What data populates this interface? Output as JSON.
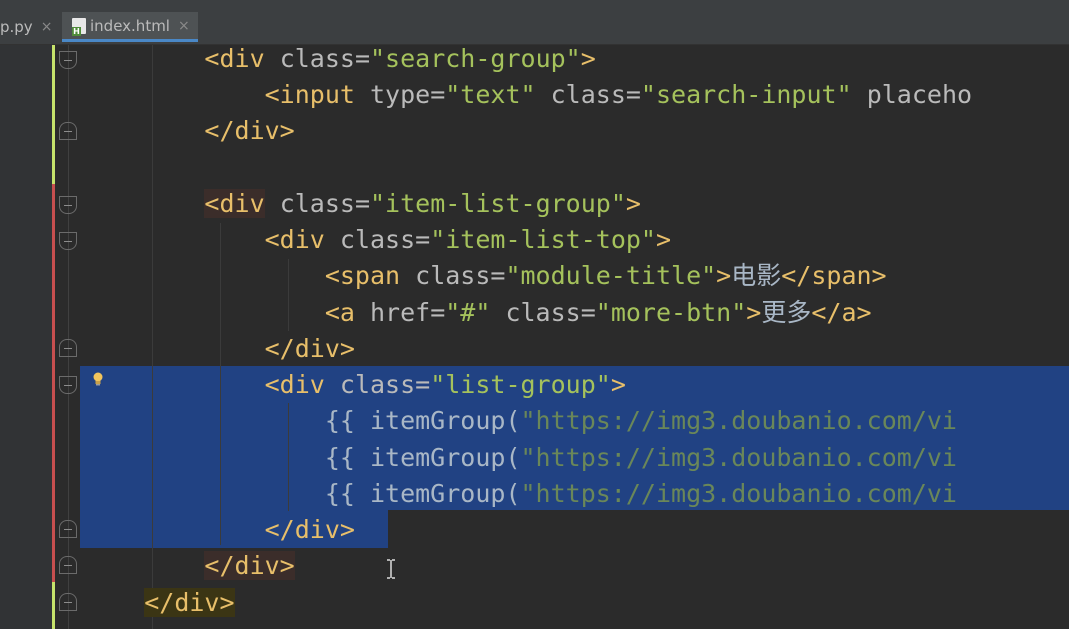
{
  "tabs": [
    {
      "label": "p.py",
      "close": "×",
      "active": false
    },
    {
      "label": "index.html",
      "close": "×",
      "active": true,
      "icon": "html-file-icon"
    }
  ],
  "code": {
    "lines": [
      {
        "indent": "        ",
        "parts": [
          {
            "t": "tag",
            "v": "<div"
          },
          {
            "t": "attr",
            "v": " class="
          },
          {
            "t": "str",
            "v": "\"search-group\""
          },
          {
            "t": "tag",
            "v": ">"
          }
        ]
      },
      {
        "indent": "            ",
        "parts": [
          {
            "t": "tag",
            "v": "<input"
          },
          {
            "t": "attr",
            "v": " type="
          },
          {
            "t": "str",
            "v": "\"text\""
          },
          {
            "t": "attr",
            "v": " class="
          },
          {
            "t": "str",
            "v": "\"search-input\""
          },
          {
            "t": "attr",
            "v": " placeho"
          }
        ]
      },
      {
        "indent": "        ",
        "parts": [
          {
            "t": "tag",
            "v": "</div>"
          }
        ]
      },
      {
        "indent": "",
        "parts": []
      },
      {
        "indent": "        ",
        "parts": [
          {
            "t": "tag",
            "v": "<div",
            "hl": true
          },
          {
            "t": "attr",
            "v": " class="
          },
          {
            "t": "str",
            "v": "\"item-list-group\""
          },
          {
            "t": "tag",
            "v": ">"
          }
        ]
      },
      {
        "indent": "            ",
        "parts": [
          {
            "t": "tag",
            "v": "<div"
          },
          {
            "t": "attr",
            "v": " class="
          },
          {
            "t": "str",
            "v": "\"item-list-top\""
          },
          {
            "t": "tag",
            "v": ">"
          }
        ]
      },
      {
        "indent": "                ",
        "parts": [
          {
            "t": "tag",
            "v": "<span"
          },
          {
            "t": "attr",
            "v": " class="
          },
          {
            "t": "str",
            "v": "\"module-title\""
          },
          {
            "t": "tag",
            "v": ">"
          },
          {
            "t": "plain",
            "v": "电影"
          },
          {
            "t": "tag",
            "v": "</span>"
          }
        ]
      },
      {
        "indent": "                ",
        "parts": [
          {
            "t": "tag",
            "v": "<a"
          },
          {
            "t": "attr",
            "v": " href="
          },
          {
            "t": "str",
            "v": "\"#\""
          },
          {
            "t": "attr",
            "v": " class="
          },
          {
            "t": "str",
            "v": "\"more-btn\""
          },
          {
            "t": "tag",
            "v": ">"
          },
          {
            "t": "plain",
            "v": "更多"
          },
          {
            "t": "tag",
            "v": "</a>"
          }
        ]
      },
      {
        "indent": "            ",
        "parts": [
          {
            "t": "tag",
            "v": "</div>"
          }
        ]
      },
      {
        "indent": "            ",
        "parts": [
          {
            "t": "tag",
            "v": "<div"
          },
          {
            "t": "attr",
            "v": " class="
          },
          {
            "t": "str",
            "v": "\"list-group\""
          },
          {
            "t": "tag",
            "v": ">"
          }
        ]
      },
      {
        "indent": "                ",
        "parts": [
          {
            "t": "plain",
            "v": "{{ itemGroup("
          },
          {
            "t": "str-sel",
            "v": "\"https://img3.doubanio.com/vi"
          }
        ]
      },
      {
        "indent": "                ",
        "parts": [
          {
            "t": "plain",
            "v": "{{ itemGroup("
          },
          {
            "t": "str-sel",
            "v": "\"https://img3.doubanio.com/vi"
          }
        ]
      },
      {
        "indent": "                ",
        "parts": [
          {
            "t": "plain",
            "v": "{{ itemGroup("
          },
          {
            "t": "str-sel",
            "v": "\"https://img3.doubanio.com/vi"
          }
        ]
      },
      {
        "indent": "            ",
        "parts": [
          {
            "t": "tag",
            "v": "</div>"
          }
        ]
      },
      {
        "indent": "        ",
        "parts": [
          {
            "t": "tag",
            "v": "</div>",
            "hl": true
          }
        ]
      },
      {
        "indent": "    ",
        "parts": [
          {
            "t": "tag",
            "v": "</div>",
            "hly": true
          }
        ]
      }
    ]
  },
  "colors": {
    "background": "#2b2b2b",
    "gutter": "#313335",
    "selection": "#214283",
    "tag": "#e8bf6a",
    "string": "#a5c25c",
    "attribute": "#bababa",
    "change_green": "#c6e36b",
    "change_red": "#c74f4f"
  }
}
